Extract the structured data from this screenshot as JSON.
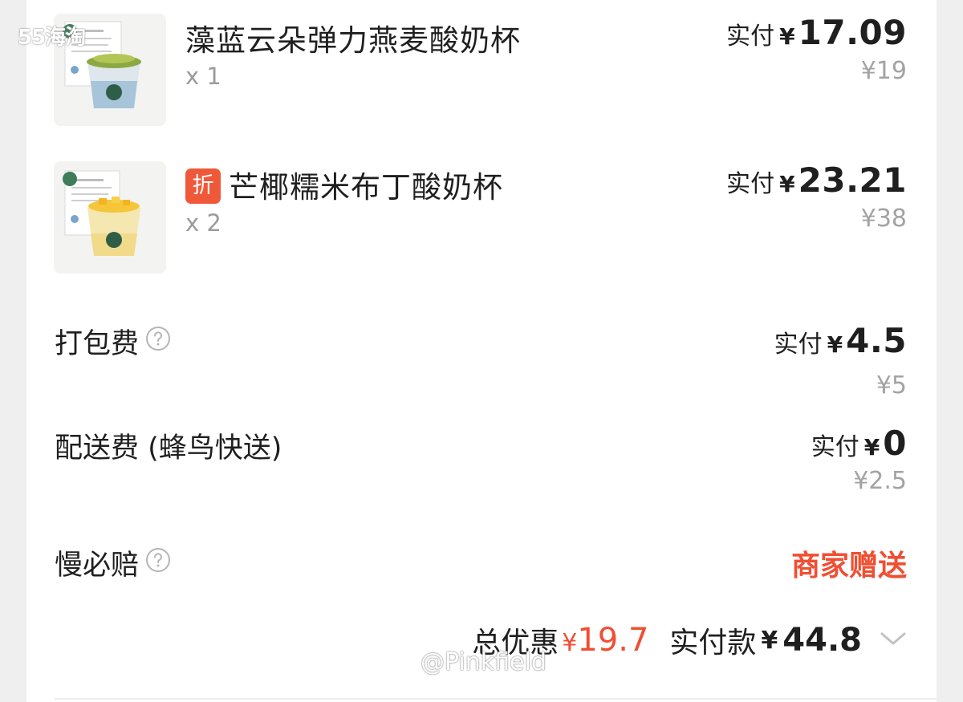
{
  "watermarks": {
    "top_left": "55海淘",
    "bottom": "@Pinkfield"
  },
  "items": [
    {
      "name": "藻蓝云朵弹力燕麦酸奶杯",
      "badge": "",
      "qty": "x 1",
      "paid_label": "实付",
      "currency": "¥",
      "paid_amount": "17.09",
      "original_price": "¥19"
    },
    {
      "name": "芒椰糯米布丁酸奶杯",
      "badge": "折",
      "qty": "x 2",
      "paid_label": "实付",
      "currency": "¥",
      "paid_amount": "23.21",
      "original_price": "¥38"
    }
  ],
  "fees": {
    "packing": {
      "label": "打包费",
      "paid_label": "实付",
      "currency": "¥",
      "paid_amount": "4.5",
      "original_price": "¥5"
    },
    "delivery": {
      "label": "配送费 (蜂鸟快送)",
      "paid_label": "实付",
      "currency": "¥",
      "paid_amount": "0",
      "original_price": "¥2.5"
    },
    "late_guarantee": {
      "label": "慢必赔",
      "value": "商家赠送"
    }
  },
  "summary": {
    "discount_label": "总优惠",
    "discount_currency": "¥",
    "discount_amount": "19.7",
    "pay_label": "实付款",
    "pay_currency": "¥",
    "pay_amount": "44.8"
  },
  "colors": {
    "accent_red": "#ef4f33",
    "badge_red": "#f0583a",
    "muted": "#a3a3a3"
  },
  "icons": [
    "help-circle-icon",
    "chevron-down-icon",
    "discount-badge"
  ]
}
